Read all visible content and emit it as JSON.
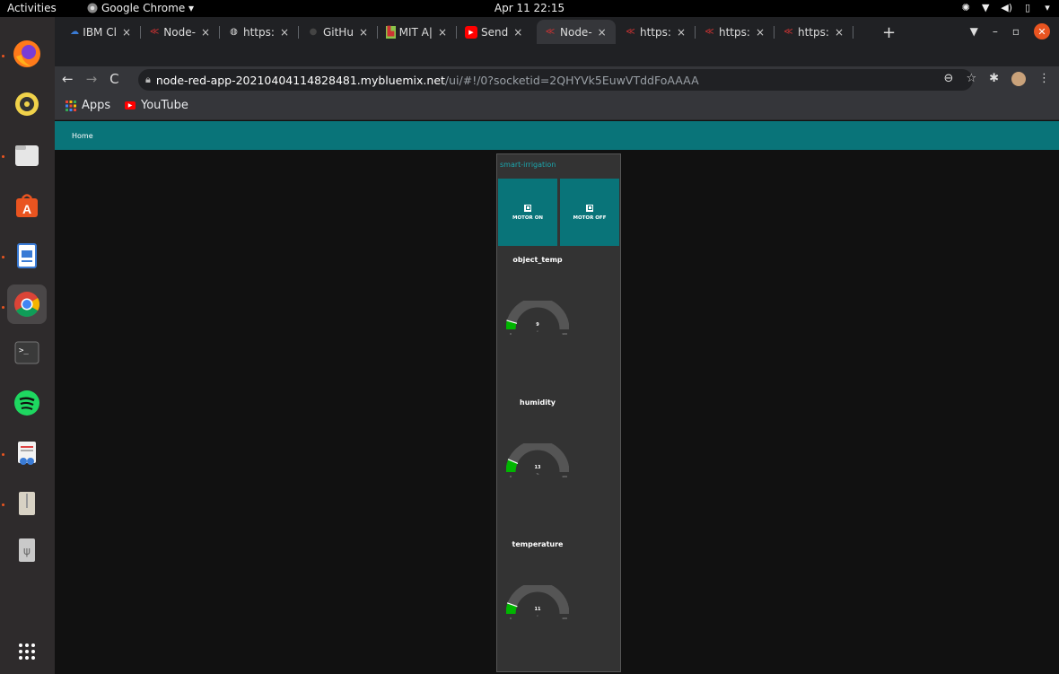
{
  "system": {
    "activities": "Activities",
    "app_menu": "Google Chrome ▾",
    "clock": "Apr 11  22:15",
    "tray_icons": [
      "brightness-icon",
      "wifi-icon",
      "volume-icon",
      "battery-icon",
      "system-menu-chevron-icon"
    ]
  },
  "dock": {
    "items": [
      {
        "name": "firefox",
        "icon": "firefox-icon"
      },
      {
        "name": "rhythmbox",
        "icon": "rhythmbox-icon"
      },
      {
        "name": "files",
        "icon": "files-icon"
      },
      {
        "name": "software",
        "icon": "software-center-icon"
      },
      {
        "name": "writer",
        "icon": "libreoffice-writer-icon"
      },
      {
        "name": "chrome",
        "icon": "chrome-icon"
      },
      {
        "name": "terminal",
        "icon": "terminal-icon"
      },
      {
        "name": "spotify",
        "icon": "spotify-icon"
      },
      {
        "name": "document-viewer",
        "icon": "document-viewer-icon"
      },
      {
        "name": "archive",
        "icon": "archive-icon"
      },
      {
        "name": "usb",
        "icon": "usb-drive-icon"
      },
      {
        "name": "show-apps",
        "icon": "show-applications-icon"
      }
    ]
  },
  "browser": {
    "tabs": [
      {
        "label": "IBM Cl",
        "close": "×"
      },
      {
        "label": "Node-",
        "close": "×"
      },
      {
        "label": "https:",
        "close": "×"
      },
      {
        "label": "GitHu",
        "close": "×"
      },
      {
        "label": "MIT A|",
        "close": "×"
      },
      {
        "label": "Send",
        "close": "×"
      },
      {
        "label": "Node-",
        "close": "×"
      },
      {
        "label": "https:",
        "close": "×"
      },
      {
        "label": "https:",
        "close": "×"
      },
      {
        "label": "https:",
        "close": "×"
      }
    ],
    "new_tab": "+",
    "url_host": "node-red-app-20210404114828481.mybluemix.net",
    "url_path": "/ui/#!/0?socketid=2QHYVk5EuwVTddFoAAAA",
    "bookmarks": [
      {
        "label": "Apps"
      },
      {
        "label": "YouTube"
      }
    ]
  },
  "dashboard": {
    "page_title": "Home",
    "group_title": "smart-irrigation",
    "buttons": [
      {
        "label": "MOTOR ON"
      },
      {
        "label": "MOTOR OFF"
      }
    ],
    "gauges": [
      {
        "label": "object_temp",
        "value": "9",
        "unit": "c",
        "min": "0",
        "max": "100",
        "color": "#00b500"
      },
      {
        "label": "humidity",
        "value": "13",
        "unit": "%",
        "min": "0",
        "max": "100",
        "color": "#00b500"
      },
      {
        "label": "temperature",
        "value": "11",
        "unit": "c",
        "min": "0",
        "max": "100",
        "color": "#00b500"
      }
    ]
  },
  "colors": {
    "dashboard_teal": "#097479",
    "group_title_teal": "#1ba7ae",
    "ubuntu_orange": "#e95420"
  }
}
